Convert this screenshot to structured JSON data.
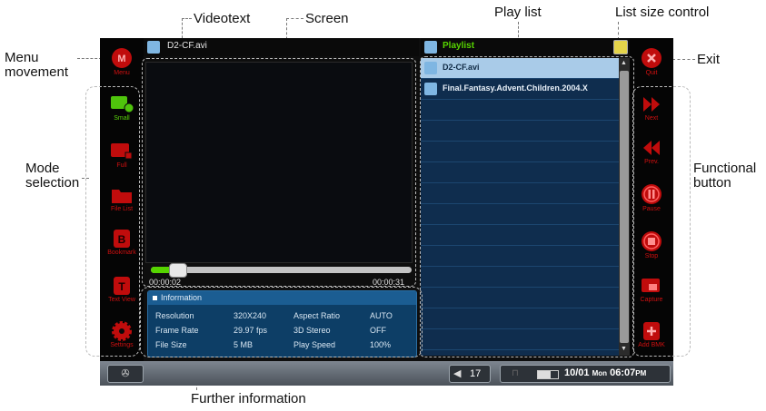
{
  "callouts": {
    "menu_movement": "Menu\nmovement",
    "videotext": "Videotext",
    "screen": "Screen",
    "play_list": "Play list",
    "list_size_control": "List size control",
    "exit": "Exit",
    "mode_selection": "Mode\nselection",
    "functional_button": "Functional\nbutton",
    "further_information": "Further information"
  },
  "left_sidebar": {
    "menu": {
      "label": "Menu",
      "icon": "m-circle-icon"
    },
    "modes": [
      {
        "label": "Small",
        "icon": "small-mode-icon",
        "active": true
      },
      {
        "label": "Full",
        "icon": "full-mode-icon",
        "active": false
      },
      {
        "label": "File List",
        "icon": "folder-icon",
        "active": false
      },
      {
        "label": "Bookmark",
        "icon": "bookmark-icon",
        "active": false
      },
      {
        "label": "Text View",
        "icon": "text-view-icon",
        "active": false
      },
      {
        "label": "Settings",
        "icon": "gear-icon",
        "active": false
      }
    ]
  },
  "right_sidebar": {
    "quit": {
      "label": "Quit",
      "icon": "close-circle-icon"
    },
    "functions": [
      {
        "label": "Next",
        "icon": "next-icon"
      },
      {
        "label": "Prev.",
        "icon": "prev-icon"
      },
      {
        "label": "Pause",
        "icon": "pause-icon"
      },
      {
        "label": "Stop",
        "icon": "stop-icon"
      },
      {
        "label": "Capture",
        "icon": "capture-icon"
      },
      {
        "label": "Add BMK",
        "icon": "add-bookmark-icon"
      }
    ]
  },
  "video": {
    "filename": "D2-CF.avi",
    "elapsed": "00:00:02",
    "total": "00:00:31",
    "progress": 0.07
  },
  "information": {
    "title": "Information",
    "rows": [
      {
        "k1": "Resolution",
        "v1": "320X240",
        "k2": "Aspect Ratio",
        "v2": "AUTO"
      },
      {
        "k1": "Frame Rate",
        "v1": "29.97 fps",
        "k2": "3D Stereo",
        "v2": "OFF"
      },
      {
        "k1": "File Size",
        "v1": "5 MB",
        "k2": "Play Speed",
        "v2": "100%"
      }
    ]
  },
  "playlist": {
    "title": "Playlist",
    "items": [
      {
        "name": "D2-CF.avi",
        "selected": true
      },
      {
        "name": "Final.Fantasy.Advent.Children.2004.X",
        "selected": false
      }
    ],
    "empty_rows": 12
  },
  "status_bar": {
    "volume": "17",
    "date": "10/01",
    "day": "Mon",
    "time": "06:07",
    "ampm": "PM"
  },
  "colors": {
    "accent_red": "#d01010",
    "accent_green": "#56d400",
    "list_bg": "#0f2d4e",
    "info_bg": "#0d3e66"
  }
}
